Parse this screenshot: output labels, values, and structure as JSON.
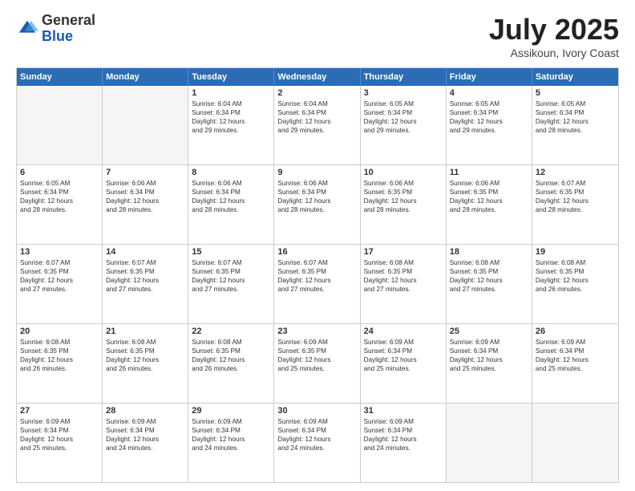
{
  "logo": {
    "general": "General",
    "blue": "Blue"
  },
  "title": {
    "month": "July 2025",
    "location": "Assikoun, Ivory Coast"
  },
  "header_days": [
    "Sunday",
    "Monday",
    "Tuesday",
    "Wednesday",
    "Thursday",
    "Friday",
    "Saturday"
  ],
  "weeks": [
    [
      {
        "day": "",
        "empty": true,
        "lines": []
      },
      {
        "day": "",
        "empty": true,
        "lines": []
      },
      {
        "day": "1",
        "empty": false,
        "lines": [
          "Sunrise: 6:04 AM",
          "Sunset: 6:34 PM",
          "Daylight: 12 hours",
          "and 29 minutes."
        ]
      },
      {
        "day": "2",
        "empty": false,
        "lines": [
          "Sunrise: 6:04 AM",
          "Sunset: 6:34 PM",
          "Daylight: 12 hours",
          "and 29 minutes."
        ]
      },
      {
        "day": "3",
        "empty": false,
        "lines": [
          "Sunrise: 6:05 AM",
          "Sunset: 6:34 PM",
          "Daylight: 12 hours",
          "and 29 minutes."
        ]
      },
      {
        "day": "4",
        "empty": false,
        "lines": [
          "Sunrise: 6:05 AM",
          "Sunset: 6:34 PM",
          "Daylight: 12 hours",
          "and 29 minutes."
        ]
      },
      {
        "day": "5",
        "empty": false,
        "lines": [
          "Sunrise: 6:05 AM",
          "Sunset: 6:34 PM",
          "Daylight: 12 hours",
          "and 28 minutes."
        ]
      }
    ],
    [
      {
        "day": "6",
        "empty": false,
        "lines": [
          "Sunrise: 6:05 AM",
          "Sunset: 6:34 PM",
          "Daylight: 12 hours",
          "and 28 minutes."
        ]
      },
      {
        "day": "7",
        "empty": false,
        "lines": [
          "Sunrise: 6:06 AM",
          "Sunset: 6:34 PM",
          "Daylight: 12 hours",
          "and 28 minutes."
        ]
      },
      {
        "day": "8",
        "empty": false,
        "lines": [
          "Sunrise: 6:06 AM",
          "Sunset: 6:34 PM",
          "Daylight: 12 hours",
          "and 28 minutes."
        ]
      },
      {
        "day": "9",
        "empty": false,
        "lines": [
          "Sunrise: 6:06 AM",
          "Sunset: 6:34 PM",
          "Daylight: 12 hours",
          "and 28 minutes."
        ]
      },
      {
        "day": "10",
        "empty": false,
        "lines": [
          "Sunrise: 6:06 AM",
          "Sunset: 6:35 PM",
          "Daylight: 12 hours",
          "and 28 minutes."
        ]
      },
      {
        "day": "11",
        "empty": false,
        "lines": [
          "Sunrise: 6:06 AM",
          "Sunset: 6:35 PM",
          "Daylight: 12 hours",
          "and 28 minutes."
        ]
      },
      {
        "day": "12",
        "empty": false,
        "lines": [
          "Sunrise: 6:07 AM",
          "Sunset: 6:35 PM",
          "Daylight: 12 hours",
          "and 28 minutes."
        ]
      }
    ],
    [
      {
        "day": "13",
        "empty": false,
        "lines": [
          "Sunrise: 6:07 AM",
          "Sunset: 6:35 PM",
          "Daylight: 12 hours",
          "and 27 minutes."
        ]
      },
      {
        "day": "14",
        "empty": false,
        "lines": [
          "Sunrise: 6:07 AM",
          "Sunset: 6:35 PM",
          "Daylight: 12 hours",
          "and 27 minutes."
        ]
      },
      {
        "day": "15",
        "empty": false,
        "lines": [
          "Sunrise: 6:07 AM",
          "Sunset: 6:35 PM",
          "Daylight: 12 hours",
          "and 27 minutes."
        ]
      },
      {
        "day": "16",
        "empty": false,
        "lines": [
          "Sunrise: 6:07 AM",
          "Sunset: 6:35 PM",
          "Daylight: 12 hours",
          "and 27 minutes."
        ]
      },
      {
        "day": "17",
        "empty": false,
        "lines": [
          "Sunrise: 6:08 AM",
          "Sunset: 6:35 PM",
          "Daylight: 12 hours",
          "and 27 minutes."
        ]
      },
      {
        "day": "18",
        "empty": false,
        "lines": [
          "Sunrise: 6:08 AM",
          "Sunset: 6:35 PM",
          "Daylight: 12 hours",
          "and 27 minutes."
        ]
      },
      {
        "day": "19",
        "empty": false,
        "lines": [
          "Sunrise: 6:08 AM",
          "Sunset: 6:35 PM",
          "Daylight: 12 hours",
          "and 26 minutes."
        ]
      }
    ],
    [
      {
        "day": "20",
        "empty": false,
        "lines": [
          "Sunrise: 6:08 AM",
          "Sunset: 6:35 PM",
          "Daylight: 12 hours",
          "and 26 minutes."
        ]
      },
      {
        "day": "21",
        "empty": false,
        "lines": [
          "Sunrise: 6:08 AM",
          "Sunset: 6:35 PM",
          "Daylight: 12 hours",
          "and 26 minutes."
        ]
      },
      {
        "day": "22",
        "empty": false,
        "lines": [
          "Sunrise: 6:08 AM",
          "Sunset: 6:35 PM",
          "Daylight: 12 hours",
          "and 26 minutes."
        ]
      },
      {
        "day": "23",
        "empty": false,
        "lines": [
          "Sunrise: 6:09 AM",
          "Sunset: 6:35 PM",
          "Daylight: 12 hours",
          "and 25 minutes."
        ]
      },
      {
        "day": "24",
        "empty": false,
        "lines": [
          "Sunrise: 6:09 AM",
          "Sunset: 6:34 PM",
          "Daylight: 12 hours",
          "and 25 minutes."
        ]
      },
      {
        "day": "25",
        "empty": false,
        "lines": [
          "Sunrise: 6:09 AM",
          "Sunset: 6:34 PM",
          "Daylight: 12 hours",
          "and 25 minutes."
        ]
      },
      {
        "day": "26",
        "empty": false,
        "lines": [
          "Sunrise: 6:09 AM",
          "Sunset: 6:34 PM",
          "Daylight: 12 hours",
          "and 25 minutes."
        ]
      }
    ],
    [
      {
        "day": "27",
        "empty": false,
        "lines": [
          "Sunrise: 6:09 AM",
          "Sunset: 6:34 PM",
          "Daylight: 12 hours",
          "and 25 minutes."
        ]
      },
      {
        "day": "28",
        "empty": false,
        "lines": [
          "Sunrise: 6:09 AM",
          "Sunset: 6:34 PM",
          "Daylight: 12 hours",
          "and 24 minutes."
        ]
      },
      {
        "day": "29",
        "empty": false,
        "lines": [
          "Sunrise: 6:09 AM",
          "Sunset: 6:34 PM",
          "Daylight: 12 hours",
          "and 24 minutes."
        ]
      },
      {
        "day": "30",
        "empty": false,
        "lines": [
          "Sunrise: 6:09 AM",
          "Sunset: 6:34 PM",
          "Daylight: 12 hours",
          "and 24 minutes."
        ]
      },
      {
        "day": "31",
        "empty": false,
        "lines": [
          "Sunrise: 6:09 AM",
          "Sunset: 6:34 PM",
          "Daylight: 12 hours",
          "and 24 minutes."
        ]
      },
      {
        "day": "",
        "empty": true,
        "lines": []
      },
      {
        "day": "",
        "empty": true,
        "lines": []
      }
    ]
  ]
}
